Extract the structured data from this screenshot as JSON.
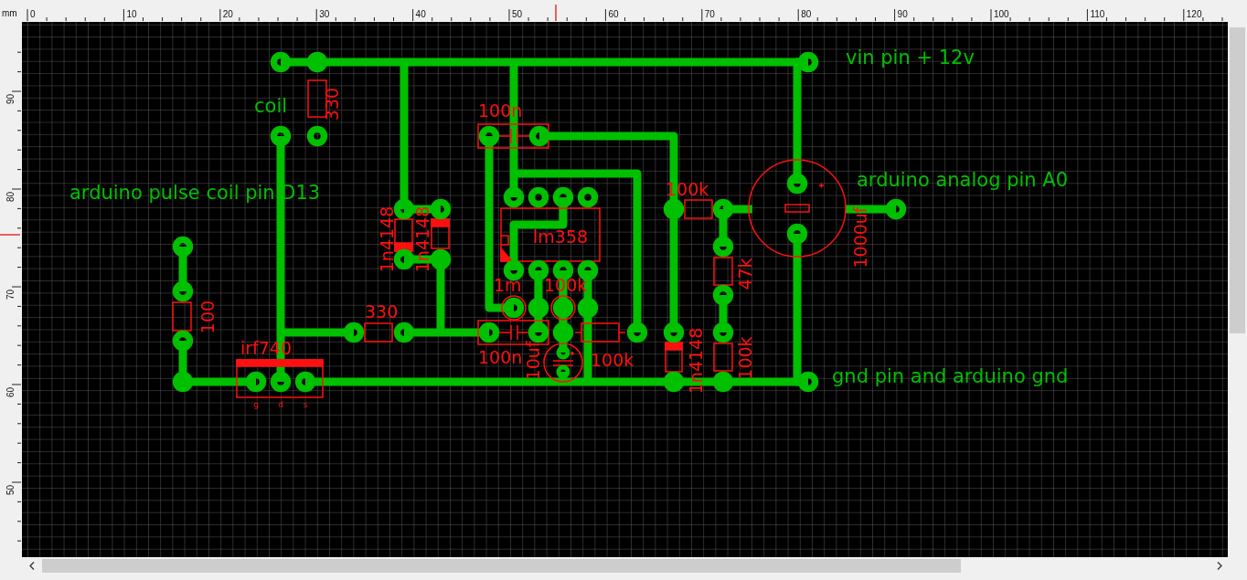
{
  "ruler": {
    "unit": "mm",
    "x_labels": [
      "0",
      "10",
      "20",
      "30",
      "40",
      "50",
      "60",
      "70",
      "80",
      "90",
      "100",
      "110",
      "120"
    ],
    "y_labels": [
      "90",
      "80",
      "70",
      "60",
      "50"
    ]
  },
  "board_labels": [
    {
      "text": "vin pin + 12v"
    },
    {
      "text": "coil"
    },
    {
      "text": "arduino pulse coil pin D13"
    },
    {
      "text": "arduino analog pin A0"
    },
    {
      "text": "gnd pin and arduino gnd"
    }
  ],
  "part_labels": [
    {
      "text": "330"
    },
    {
      "text": "100n"
    },
    {
      "text": "lm358"
    },
    {
      "text": "1n4148"
    },
    {
      "text": "1n4148"
    },
    {
      "text": "330"
    },
    {
      "text": "100"
    },
    {
      "text": "irf740"
    },
    {
      "text": "1m"
    },
    {
      "text": "100k"
    },
    {
      "text": "100n"
    },
    {
      "text": "10uf"
    },
    {
      "text": "100k"
    },
    {
      "text": "100k"
    },
    {
      "text": "47k"
    },
    {
      "text": "1n4148"
    },
    {
      "text": "100k"
    },
    {
      "text": "1000uf"
    }
  ],
  "pin_labels": [
    "g",
    "d",
    "s"
  ]
}
